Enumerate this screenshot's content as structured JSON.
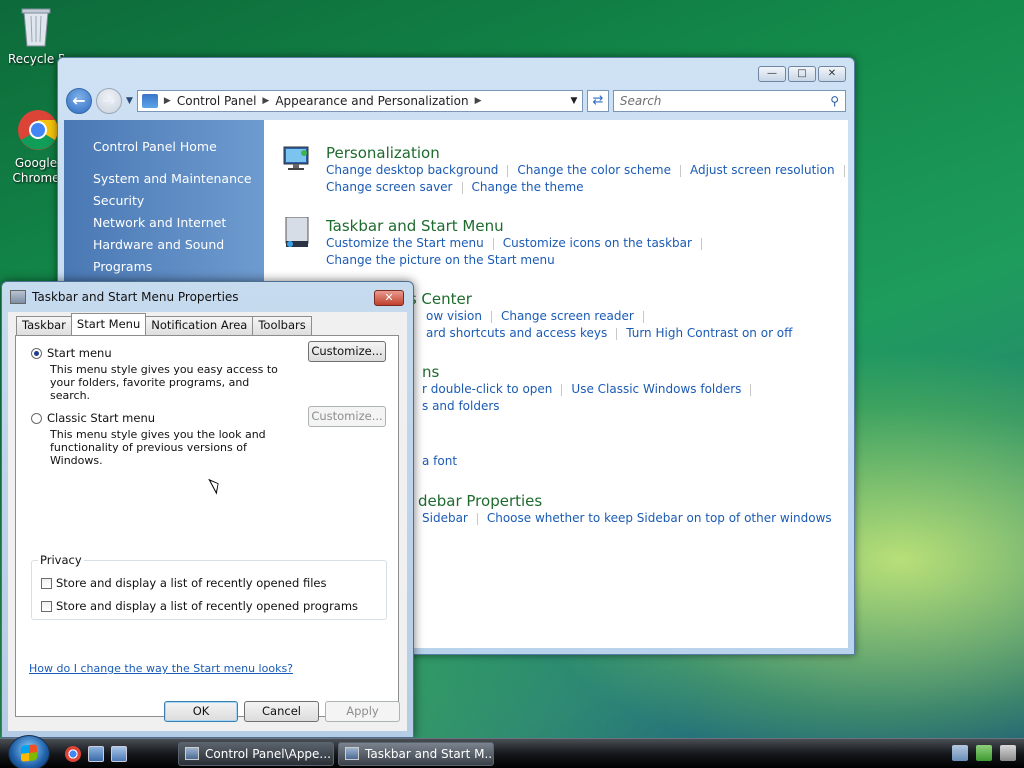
{
  "desktop": {
    "icons": [
      {
        "label": "Recycle Bin"
      },
      {
        "label": "Google Chrome"
      }
    ]
  },
  "control_panel": {
    "breadcrumb": [
      "Control Panel",
      "Appearance and Personalization"
    ],
    "search_placeholder": "Search",
    "sidebar": {
      "home": "Control Panel Home",
      "items": [
        "System and Maintenance",
        "Security",
        "Network and Internet",
        "Hardware and Sound",
        "Programs"
      ]
    },
    "categories": [
      {
        "title": "Personalization",
        "links": [
          [
            "Change desktop background",
            "Change the color scheme",
            "Adjust screen resolution"
          ],
          [
            "Change screen saver",
            "Change the theme"
          ]
        ]
      },
      {
        "title": "Taskbar and Start Menu",
        "links": [
          [
            "Customize the Start menu",
            "Customize icons on the taskbar"
          ],
          [
            "Change the picture on the Start menu"
          ]
        ]
      },
      {
        "title": "ss Center",
        "links": [
          [
            "ow vision",
            "Change screen reader"
          ],
          [
            "ard shortcuts and access keys",
            "Turn High Contrast on or off"
          ]
        ]
      },
      {
        "title": "ns",
        "links": [
          [
            "r double-click to open",
            "Use Classic Windows folders"
          ],
          [
            "s and folders"
          ]
        ]
      },
      {
        "title": "",
        "links": [
          [
            "a font"
          ]
        ]
      },
      {
        "title": "debar Properties",
        "links": [
          [
            "Sidebar",
            "Choose whether to keep Sidebar on top of other windows"
          ]
        ]
      }
    ]
  },
  "dialog": {
    "title": "Taskbar and Start Menu Properties",
    "tabs": [
      "Taskbar",
      "Start Menu",
      "Notification Area",
      "Toolbars"
    ],
    "active_tab": "Start Menu",
    "start_menu": {
      "label": "Start menu",
      "selected": true,
      "description": "This menu style gives you easy access to your folders, favorite programs, and search.",
      "customize": "Customize..."
    },
    "classic_menu": {
      "label": "Classic Start menu",
      "selected": false,
      "description": "This menu style gives you the look and functionality of previous versions of Windows.",
      "customize": "Customize..."
    },
    "privacy": {
      "title": "Privacy",
      "files_label": "Store and display a list of recently opened files",
      "files_checked": false,
      "programs_label": "Store and display a list of recently opened programs",
      "programs_checked": false
    },
    "help_link": "How do I change the way the Start menu looks?",
    "buttons": {
      "ok": "OK",
      "cancel": "Cancel",
      "apply": "Apply"
    }
  },
  "taskbar": {
    "buttons": [
      "Control Panel\\Appe...",
      "Taskbar and Start M..."
    ]
  }
}
